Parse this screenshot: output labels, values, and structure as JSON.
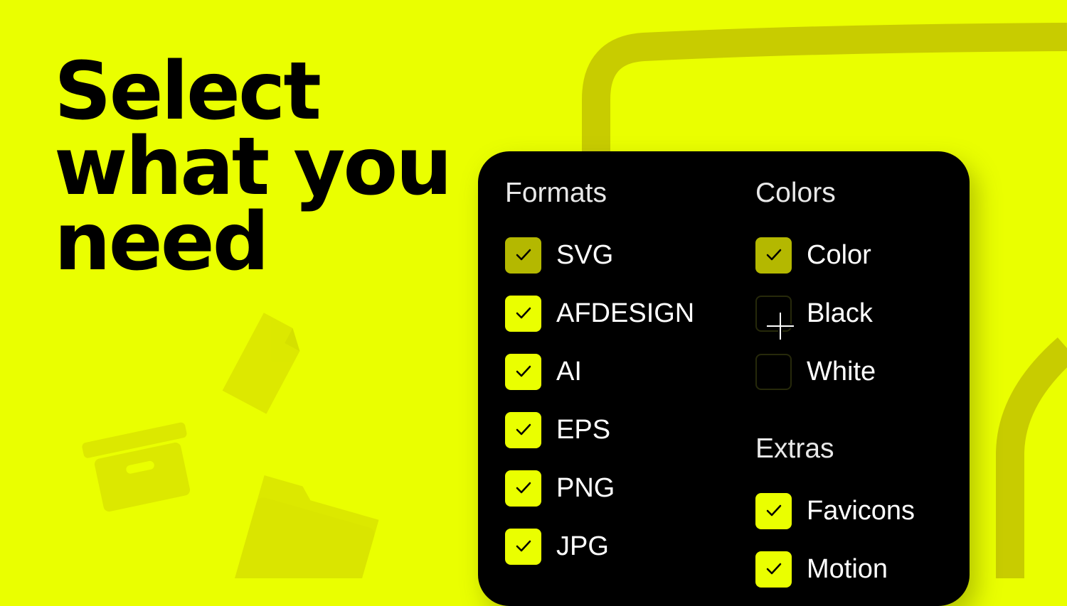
{
  "background_color": "#eaff00",
  "panel_color": "#000000",
  "headline": {
    "lines": [
      "Select",
      "what you",
      "need"
    ]
  },
  "formats": {
    "title": "Formats",
    "options": [
      {
        "label": "SVG",
        "checked": true,
        "state": "dimmed"
      },
      {
        "label": "AFDESIGN",
        "checked": true,
        "state": "on"
      },
      {
        "label": "AI",
        "checked": true,
        "state": "on"
      },
      {
        "label": "EPS",
        "checked": true,
        "state": "on"
      },
      {
        "label": "PNG",
        "checked": true,
        "state": "on"
      },
      {
        "label": "JPG",
        "checked": true,
        "state": "on"
      }
    ]
  },
  "colors": {
    "title": "Colors",
    "options": [
      {
        "label": "Color",
        "checked": true,
        "state": "dimmed"
      },
      {
        "label": "Black",
        "checked": false,
        "state": "off"
      },
      {
        "label": "White",
        "checked": false,
        "state": "off"
      }
    ]
  },
  "extras": {
    "title": "Extras",
    "options": [
      {
        "label": "Favicons",
        "checked": true,
        "state": "on"
      },
      {
        "label": "Motion",
        "checked": true,
        "state": "on"
      }
    ]
  },
  "icons": {
    "check": "check-icon",
    "cursor": "crosshair-cursor-icon",
    "decor": [
      "document-icon",
      "archive-box-icon",
      "folder-icon"
    ]
  },
  "accent_colors": {
    "checked": "#eaff00",
    "dimmed": "#b4b800",
    "decor": "#c8cc00"
  }
}
